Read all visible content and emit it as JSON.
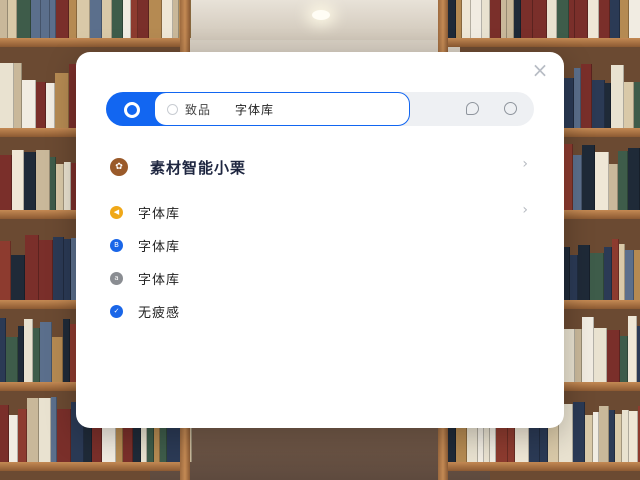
{
  "dialog": {
    "close_label": "×",
    "search": {
      "prefix": "致品",
      "query": "字体库"
    },
    "section": {
      "title": "素材智能小栗",
      "chevron": "›"
    },
    "items": [
      {
        "label": "字体库",
        "color": "#f0a818",
        "icon": "play-icon",
        "chevron": "›"
      },
      {
        "label": "字体库",
        "color": "#1a66e8",
        "icon": "font-icon"
      },
      {
        "label": "字体库",
        "color": "#8a8d92",
        "icon": "font-icon"
      },
      {
        "label": "无疲感",
        "color": "#1a66e8",
        "icon": "check-icon"
      }
    ]
  },
  "colors": {
    "accent": "#1266f1",
    "section_icon": "#9a5a2a",
    "title_text": "#1e2640"
  }
}
